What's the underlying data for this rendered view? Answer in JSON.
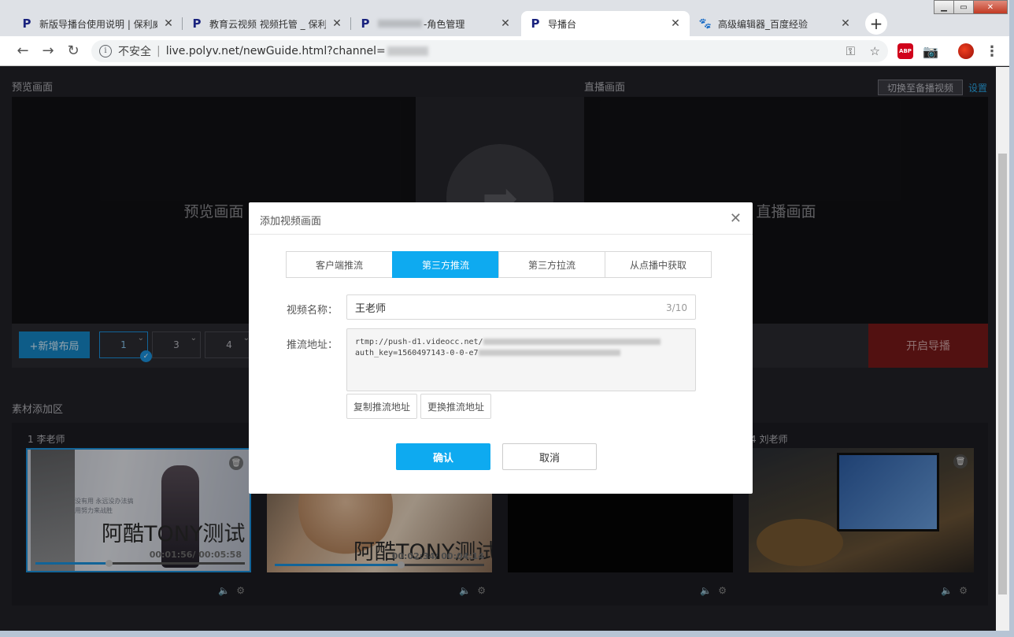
{
  "browser": {
    "tabs": [
      {
        "title": "新版导播台使用说明 | 保利威",
        "icon": "polyv-logo",
        "active": false
      },
      {
        "title": "教育云视频 视频托管 _ 保利威",
        "icon": "polyv-logo",
        "active": false
      },
      {
        "title": "-角色管理",
        "icon": "polyv-logo",
        "active": false
      },
      {
        "title": "导播台",
        "icon": "polyv-logo",
        "active": true
      },
      {
        "title": "高级编辑器_百度经验",
        "icon": "baidu-paw",
        "active": false
      }
    ],
    "new_tab_label": "+",
    "security_label": "不安全",
    "url": "live.polyv.net/newGuide.html?channel=",
    "extensions": {
      "abp_label": "ABP"
    }
  },
  "page": {
    "preview": {
      "section_label": "预览画面",
      "placeholder": "预览画面"
    },
    "live": {
      "section_label": "直播画面",
      "placeholder": "直播画面",
      "backup_button": "切换至备播视频",
      "settings_link": "设置"
    },
    "controls": {
      "add_layout": "+新增布局",
      "layouts": [
        "1",
        "3",
        "4"
      ],
      "selected_layout": "1",
      "start_button": "开启导播"
    },
    "materials": {
      "section_label": "素材添加区",
      "items": [
        {
          "name": "1 李老师",
          "time": "00:01:56/ 00:05:58",
          "title": "阿酷TONY测试",
          "progress": 0.35,
          "overlay_line1": "没有用 永远没办法搞",
          "overlay_line2": "用努力来战胜"
        },
        {
          "name": "",
          "time": "00:02:34/ 00:04:14",
          "title": "阿酷TONY测试",
          "progress": 0.6
        },
        {
          "name": "",
          "time": "",
          "title": ""
        },
        {
          "name": "4 刘老师",
          "time": "",
          "title": ""
        }
      ]
    }
  },
  "modal": {
    "title": "添加视频画面",
    "tabs": [
      "客户端推流",
      "第三方推流",
      "第三方拉流",
      "从点播中获取"
    ],
    "active_tab": "第三方推流",
    "name_label": "视频名称：",
    "name_value": "王老师",
    "name_count": "3/10",
    "push_label": "推流地址：",
    "push_line1": "rtmp://push-d1.videocc.net/",
    "push_line2": "auth_key=1560497143-0-0-e7",
    "copy_button": "复制推流地址",
    "replace_button": "更换推流地址",
    "ok_button": "确认",
    "cancel_button": "取消"
  },
  "colors": {
    "accent": "#0eaaf0",
    "start": "#7a1a1a"
  }
}
